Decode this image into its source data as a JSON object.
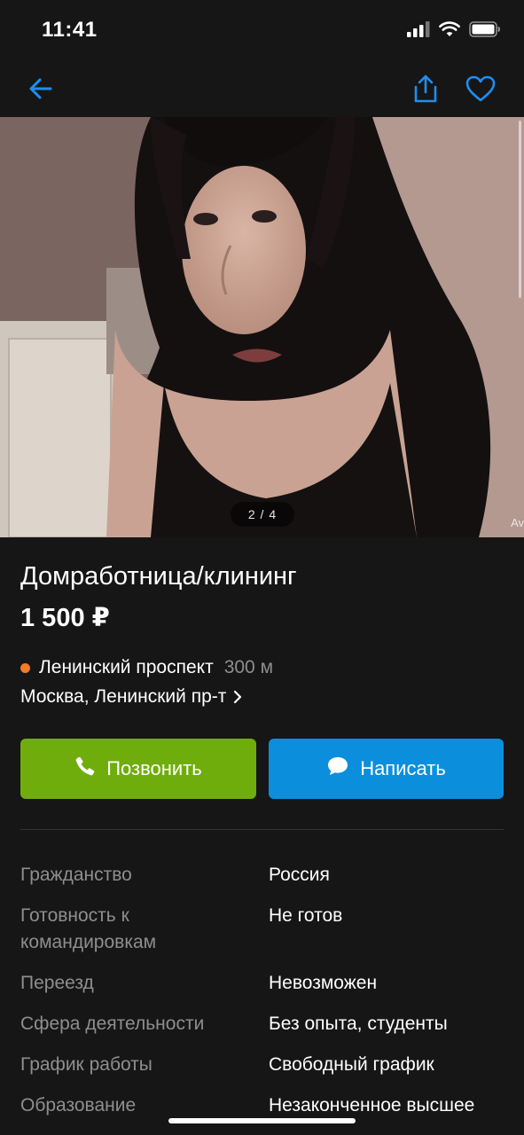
{
  "status_bar": {
    "time": "11:41",
    "signal_icon": "cellular-signal-icon",
    "wifi_icon": "wifi-icon",
    "battery_icon": "battery-icon"
  },
  "nav": {
    "back_icon": "arrow-left-icon",
    "share_icon": "share-icon",
    "favorite_icon": "heart-icon",
    "accent_color": "#1e8ff0"
  },
  "gallery": {
    "pager_text": "2 / 4",
    "watermark": "Av"
  },
  "listing": {
    "title": "Домработница/клининг",
    "price": "1 500 ₽",
    "metro_station": "Ленинский проспект",
    "metro_distance": "300 м",
    "metro_color": "#f07d2a",
    "address": "Москва, Ленинский пр-т"
  },
  "actions": {
    "call_label": "Позвонить",
    "call_icon": "phone-icon",
    "call_color": "#6fad0d",
    "write_label": "Написать",
    "write_icon": "chat-bubble-icon",
    "write_color": "#0b8fdd"
  },
  "params": [
    {
      "label": "Гражданство",
      "value": "Россия"
    },
    {
      "label": "Готовность к командировкам",
      "value": "Не готов"
    },
    {
      "label": "Переезд",
      "value": "Невозможен"
    },
    {
      "label": "Сфера деятельности",
      "value": "Без опыта, студенты"
    },
    {
      "label": "График работы",
      "value": "Свободный график"
    },
    {
      "label": "Образование",
      "value": "Незаконченное высшее"
    }
  ]
}
